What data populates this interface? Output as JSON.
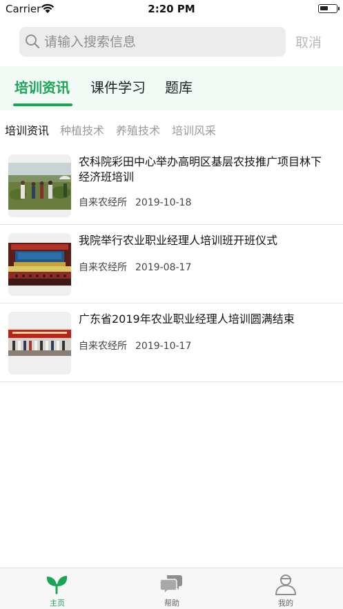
{
  "status_bar": {
    "carrier": "Carrier",
    "time": "2:20 PM"
  },
  "search": {
    "placeholder": "请输入搜索信息",
    "cancel_label": "取消"
  },
  "tabs": [
    {
      "label": "培训资讯",
      "active": true
    },
    {
      "label": "课件学习",
      "active": false
    },
    {
      "label": "题库",
      "active": false
    }
  ],
  "subtabs": [
    {
      "label": "培训资讯",
      "active": true
    },
    {
      "label": "种植技术",
      "active": false
    },
    {
      "label": "养殖技术",
      "active": false
    },
    {
      "label": "培训风采",
      "active": false
    }
  ],
  "news": [
    {
      "title": "农科院彩田中心举办高明区基层农技推广项目林下经济班培训",
      "source": "自来农经所",
      "date": "2019-10-18",
      "thumb": "field-photo"
    },
    {
      "title": "我院举行农业职业经理人培训班开班仪式",
      "source": "自来农经所",
      "date": "2019-08-17",
      "thumb": "meeting-hall-photo"
    },
    {
      "title": "广东省2019年农业职业经理人培训圆满结束",
      "source": "自来农经所",
      "date": "2019-10-17",
      "thumb": "group-photo"
    }
  ],
  "tabbar": [
    {
      "label": "主页",
      "icon": "sprout-icon",
      "active": true
    },
    {
      "label": "帮助",
      "icon": "chat-bubbles-icon",
      "active": false
    },
    {
      "label": "我的",
      "icon": "user-icon",
      "active": false
    }
  ],
  "colors": {
    "accent": "#1ba556",
    "tab_bg": "#f1faf5",
    "search_bg": "#ececec"
  }
}
